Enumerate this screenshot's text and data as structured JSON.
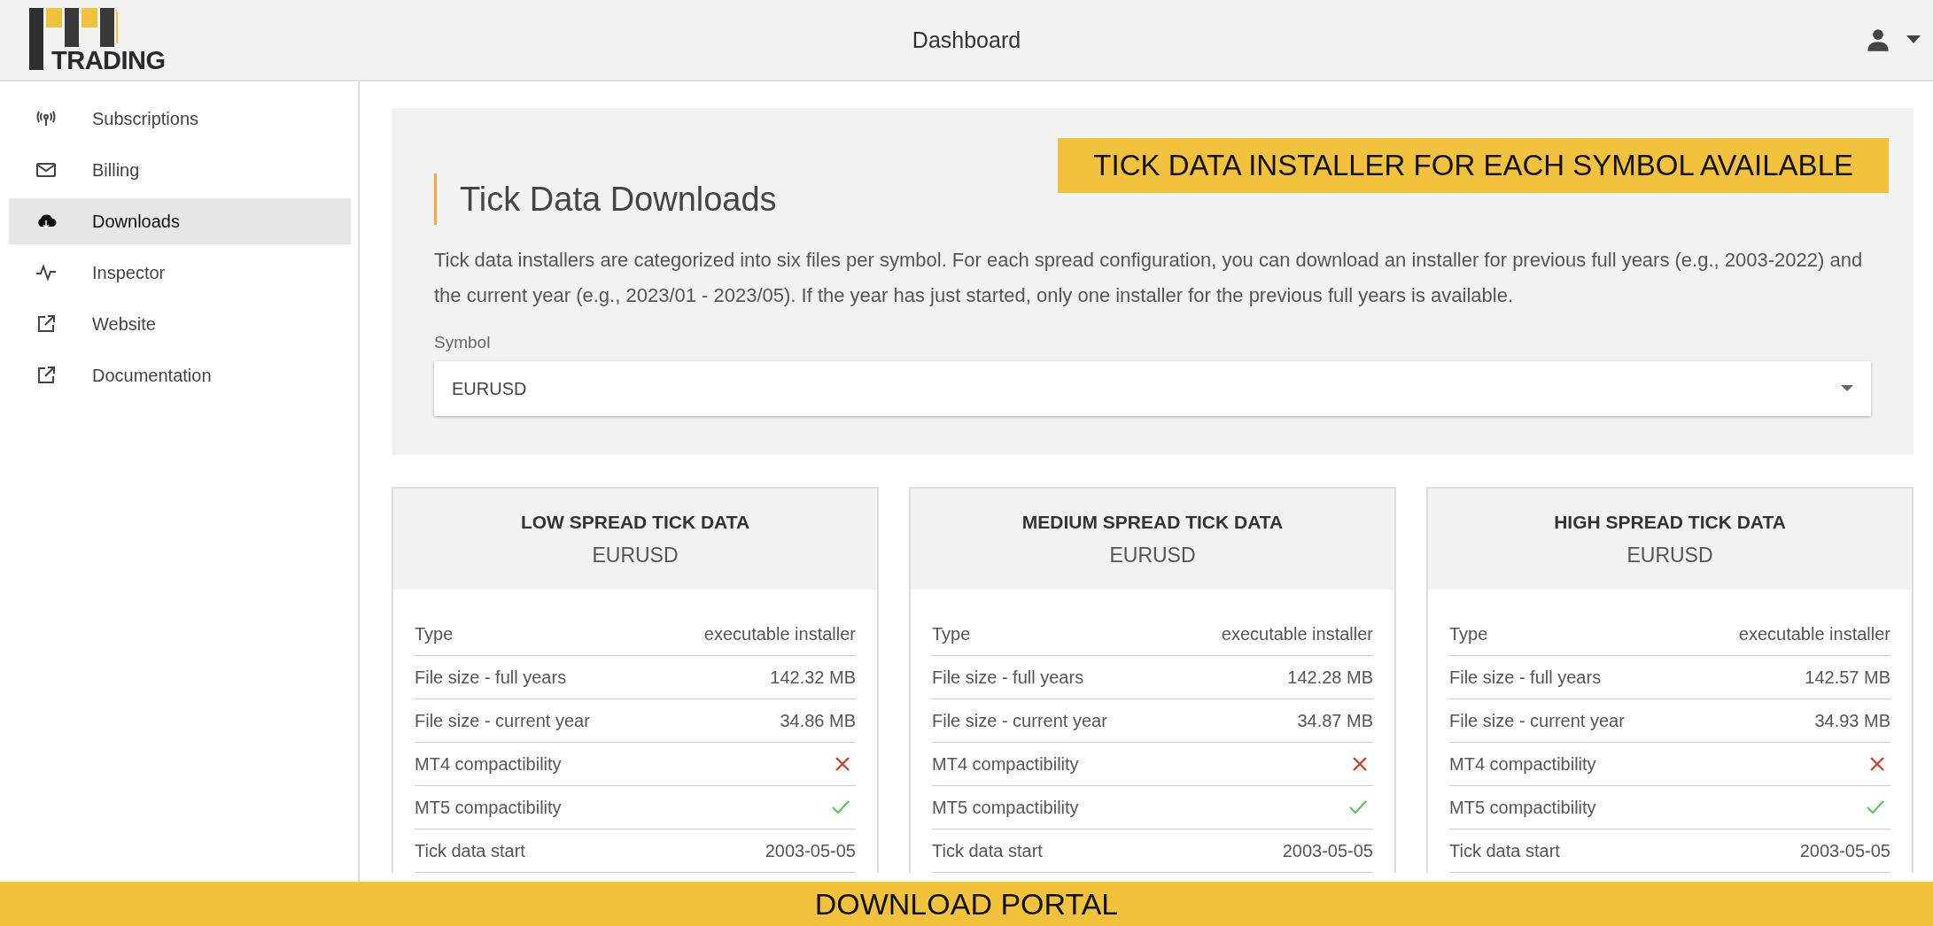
{
  "header": {
    "logo_text": "TRADING",
    "title": "Dashboard"
  },
  "sidebar": {
    "items": [
      {
        "label": "Subscriptions",
        "kind": "antenna",
        "selected": false
      },
      {
        "label": "Billing",
        "kind": "mail",
        "selected": false
      },
      {
        "label": "Downloads",
        "kind": "cloud",
        "selected": true
      },
      {
        "label": "Inspector",
        "kind": "pulse",
        "selected": false
      },
      {
        "label": "Website",
        "kind": "external",
        "selected": false
      },
      {
        "label": "Documentation",
        "kind": "external",
        "selected": false
      }
    ]
  },
  "panel": {
    "title": "Tick Data Downloads",
    "callout": "TICK DATA INSTALLER FOR EACH SYMBOL AVAILABLE",
    "description": "Tick data installers are categorized into six files per symbol. For each spread configuration, you can download an installer for previous full years (e.g., 2003-2022) and the current year (e.g., 2023/01 - 2023/05). If the year has just started, only one installer for the previous full years is available.",
    "symbol_label": "Symbol",
    "symbol_value": "EURUSD"
  },
  "cards": [
    {
      "title": "LOW SPREAD TICK DATA",
      "symbol": "EURUSD",
      "rows": [
        {
          "kind": "text",
          "label": "Type",
          "value": "executable installer"
        },
        {
          "kind": "text",
          "label": "File size - full years",
          "value": "142.32 MB"
        },
        {
          "kind": "text",
          "label": "File size - current year",
          "value": "34.86 MB"
        },
        {
          "kind": "check",
          "label": "MT4 compactibility",
          "ok": false
        },
        {
          "kind": "check",
          "label": "MT5 compactibility",
          "ok": true
        },
        {
          "kind": "text",
          "label": "Tick data start",
          "value": "2003-05-05"
        }
      ]
    },
    {
      "title": "MEDIUM SPREAD TICK DATA",
      "symbol": "EURUSD",
      "rows": [
        {
          "kind": "text",
          "label": "Type",
          "value": "executable installer"
        },
        {
          "kind": "text",
          "label": "File size - full years",
          "value": "142.28 MB"
        },
        {
          "kind": "text",
          "label": "File size - current year",
          "value": "34.87 MB"
        },
        {
          "kind": "check",
          "label": "MT4 compactibility",
          "ok": false
        },
        {
          "kind": "check",
          "label": "MT5 compactibility",
          "ok": true
        },
        {
          "kind": "text",
          "label": "Tick data start",
          "value": "2003-05-05"
        }
      ]
    },
    {
      "title": "HIGH SPREAD TICK DATA",
      "symbol": "EURUSD",
      "rows": [
        {
          "kind": "text",
          "label": "Type",
          "value": "executable installer"
        },
        {
          "kind": "text",
          "label": "File size - full years",
          "value": "142.57 MB"
        },
        {
          "kind": "text",
          "label": "File size - current year",
          "value": "34.93 MB"
        },
        {
          "kind": "check",
          "label": "MT4 compactibility",
          "ok": false
        },
        {
          "kind": "check",
          "label": "MT5 compactibility",
          "ok": true
        },
        {
          "kind": "text",
          "label": "Tick data start",
          "value": "2003-05-05"
        }
      ]
    }
  ],
  "footer_banner": "DOWNLOAD PORTAL"
}
